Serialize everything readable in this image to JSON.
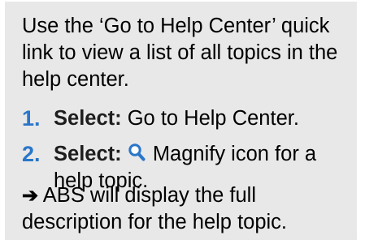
{
  "intro": "Use the ‘Go to Help Center’ quick link to view a list of all topics in the help center.",
  "steps": [
    {
      "number": "1.",
      "label": "Select:",
      "text": "Go to Help Center."
    },
    {
      "number": "2.",
      "label": "Select:",
      "icon": "magnify-icon",
      "text": "Magnify icon for a help topic."
    }
  ],
  "result": {
    "arrow": "➔",
    "text": "ABS will display the full description for the help topic."
  },
  "colors": {
    "panel_background": "#e8e8e8",
    "step_number": "#2a76c9",
    "icon": "#2a76c9"
  }
}
